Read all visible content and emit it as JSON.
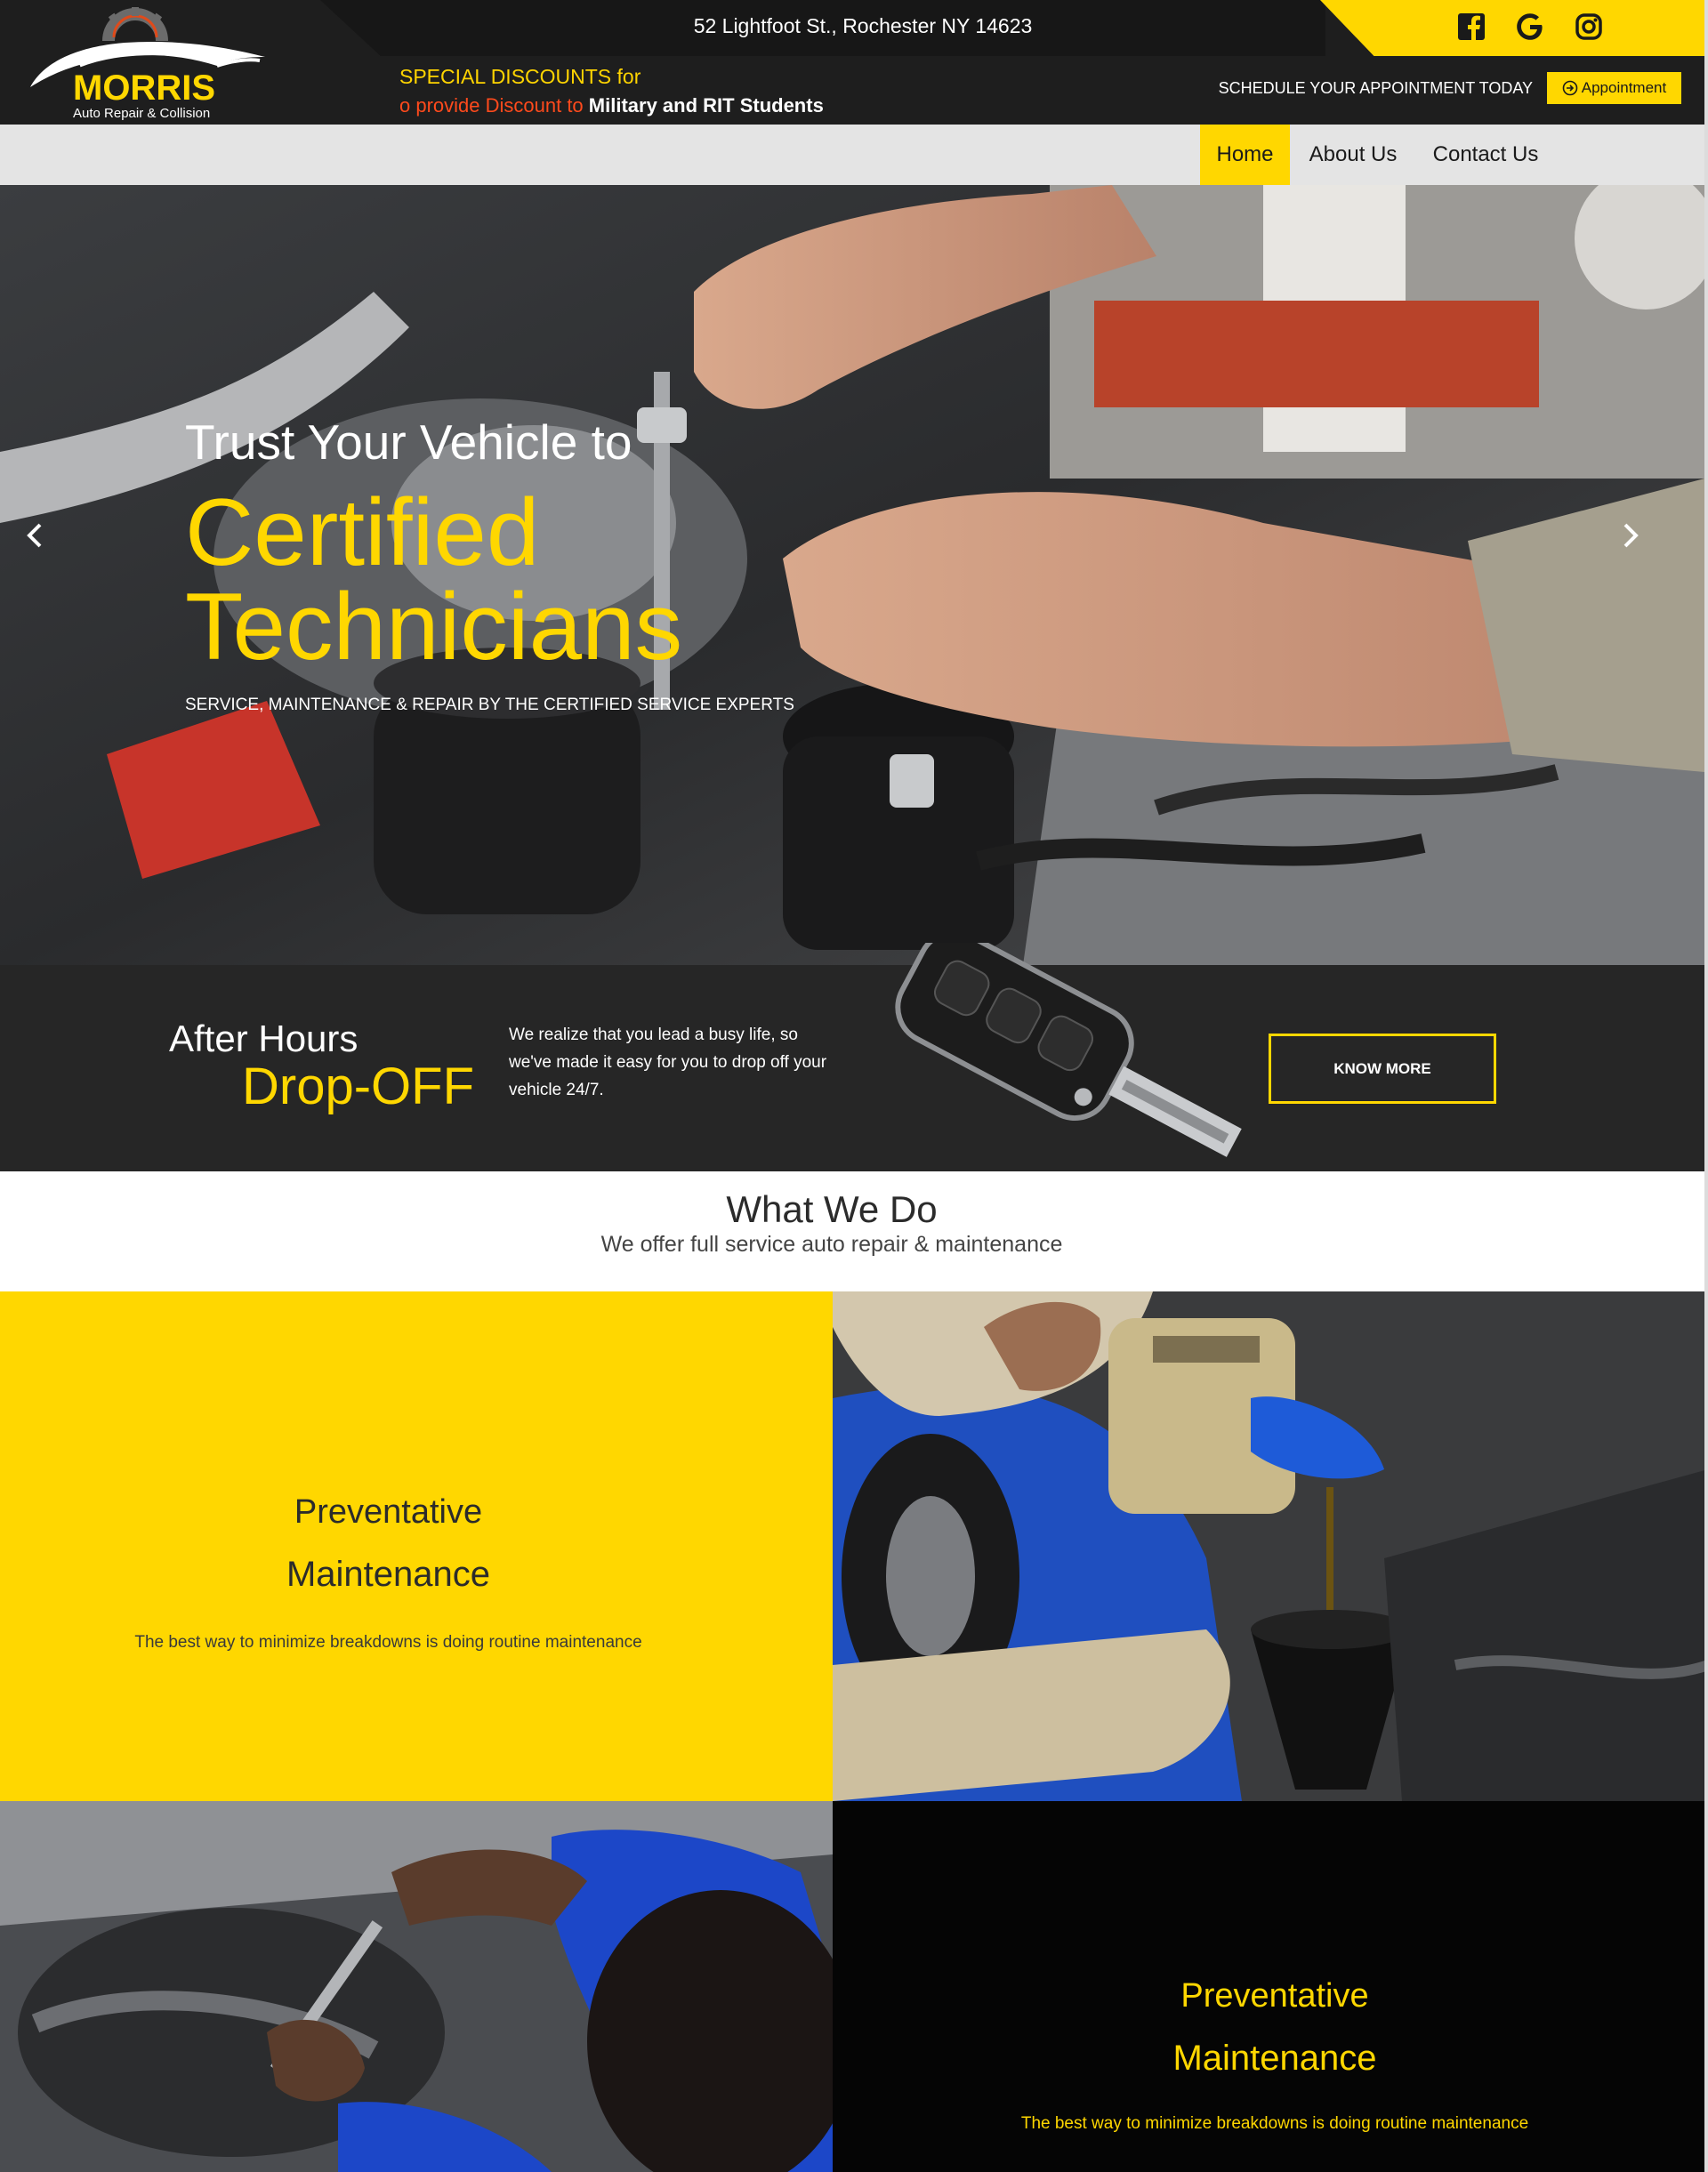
{
  "header": {
    "logo": {
      "name": "MORRIS",
      "tagline": "Auto Repair & Collision"
    },
    "address": "52 Lightfoot St., Rochester NY 14623",
    "social": [
      "facebook-icon",
      "google-icon",
      "instagram-icon"
    ],
    "promo": {
      "title": "SPECIAL DISCOUNTS for",
      "line_red": "o provide Discount to ",
      "line_white": "Military and RIT Students"
    },
    "schedule_text": "SCHEDULE YOUR APPOINTMENT TODAY",
    "appointment_label": "Appointment"
  },
  "nav": {
    "items": [
      {
        "label": "Home",
        "active": true
      },
      {
        "label": "About Us",
        "active": false
      },
      {
        "label": "Contact Us",
        "active": false
      }
    ]
  },
  "hero": {
    "pre_title": "Trust Your Vehicle to",
    "title": "Certified Technicians",
    "subtitle": "SERVICE, MAINTENANCE & REPAIR BY THE CERTIFIED SERVICE EXPERTS"
  },
  "dropoff": {
    "heading": "After Hours",
    "highlight": "Drop-OFF",
    "description": "We realize that you lead a busy life, so we've made it easy for you to drop off your vehicle 24/7.",
    "button": "KNOW MORE"
  },
  "what_we_do": {
    "title": "What We Do",
    "subtitle": "We offer full service auto repair & maintenance"
  },
  "services": [
    {
      "title_line1": "Preventative",
      "title_line2": "Maintenance",
      "description": "The best way to minimize breakdowns is doing routine maintenance"
    },
    {
      "title_line1": "Preventative",
      "title_line2": "Maintenance",
      "description": "The best way to minimize breakdowns is doing routine maintenance"
    }
  ],
  "colors": {
    "accent": "#ffd700",
    "dark": "#1e1e1e",
    "promo_red": "#ff4a1c"
  }
}
